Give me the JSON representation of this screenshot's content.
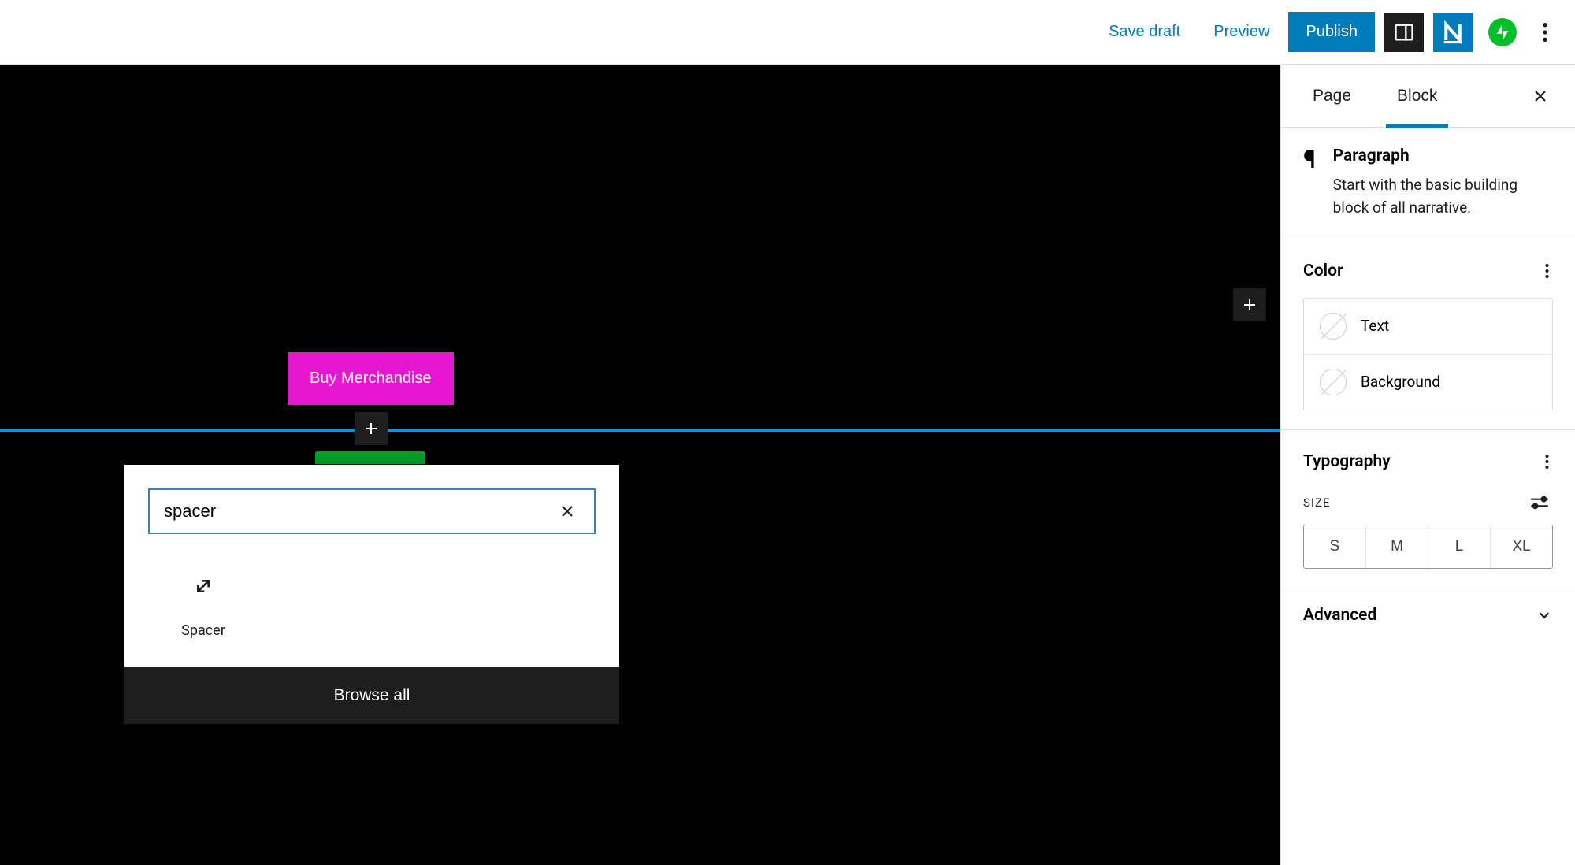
{
  "toolbar": {
    "save_draft": "Save draft",
    "preview": "Preview",
    "publish": "Publish"
  },
  "canvas": {
    "buy_merch_label": "Buy Merchandise"
  },
  "inserter": {
    "search_value": "spacer",
    "results": [
      {
        "label": "Spacer"
      }
    ],
    "browse_all": "Browse all"
  },
  "sidebar": {
    "tabs": {
      "page": "Page",
      "block": "Block"
    },
    "block_info": {
      "title": "Paragraph",
      "desc": "Start with the basic building block of all narrative."
    },
    "color": {
      "title": "Color",
      "text_label": "Text",
      "background_label": "Background"
    },
    "typography": {
      "title": "Typography",
      "size_label": "Size",
      "sizes": [
        "S",
        "M",
        "L",
        "XL"
      ]
    },
    "advanced": {
      "title": "Advanced"
    }
  }
}
